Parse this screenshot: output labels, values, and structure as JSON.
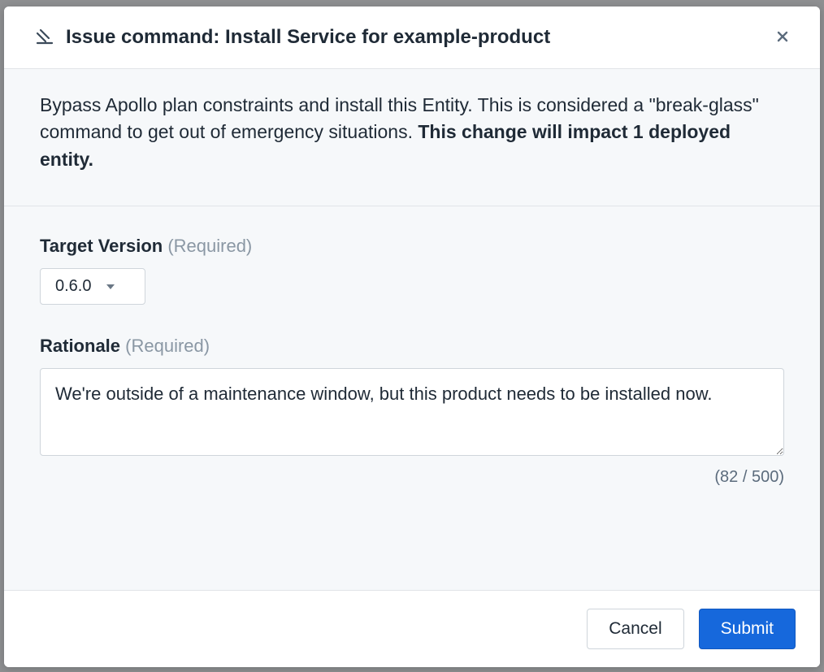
{
  "modal": {
    "title": "Issue command: Install Service for example-product",
    "description_plain": "Bypass Apollo plan constraints and install this Entity. This is considered a \"break-glass\" command to get out of emergency situations. ",
    "description_bold": "This change will impact 1 deployed entity."
  },
  "fields": {
    "target_version": {
      "label": "Target Version",
      "required_text": "(Required)",
      "value": "0.6.0"
    },
    "rationale": {
      "label": "Rationale",
      "required_text": "(Required)",
      "value": "We're outside of a maintenance window, but this product needs to be installed now.",
      "counter": "(82 / 500)"
    }
  },
  "footer": {
    "cancel": "Cancel",
    "submit": "Submit"
  }
}
